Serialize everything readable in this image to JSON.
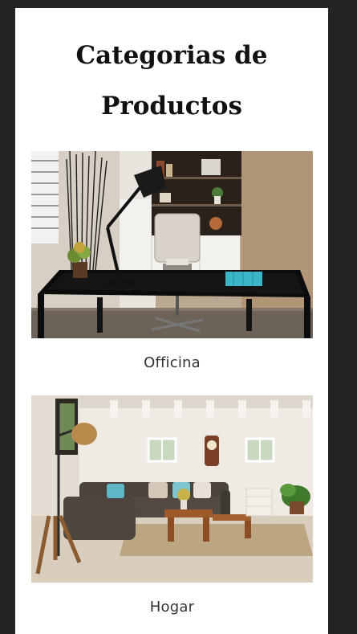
{
  "page": {
    "title": "Categorias de Productos"
  },
  "categories": [
    {
      "label": "Officina",
      "image": "office-desk-photo"
    },
    {
      "label": "Hogar",
      "image": "living-room-photo"
    }
  ]
}
